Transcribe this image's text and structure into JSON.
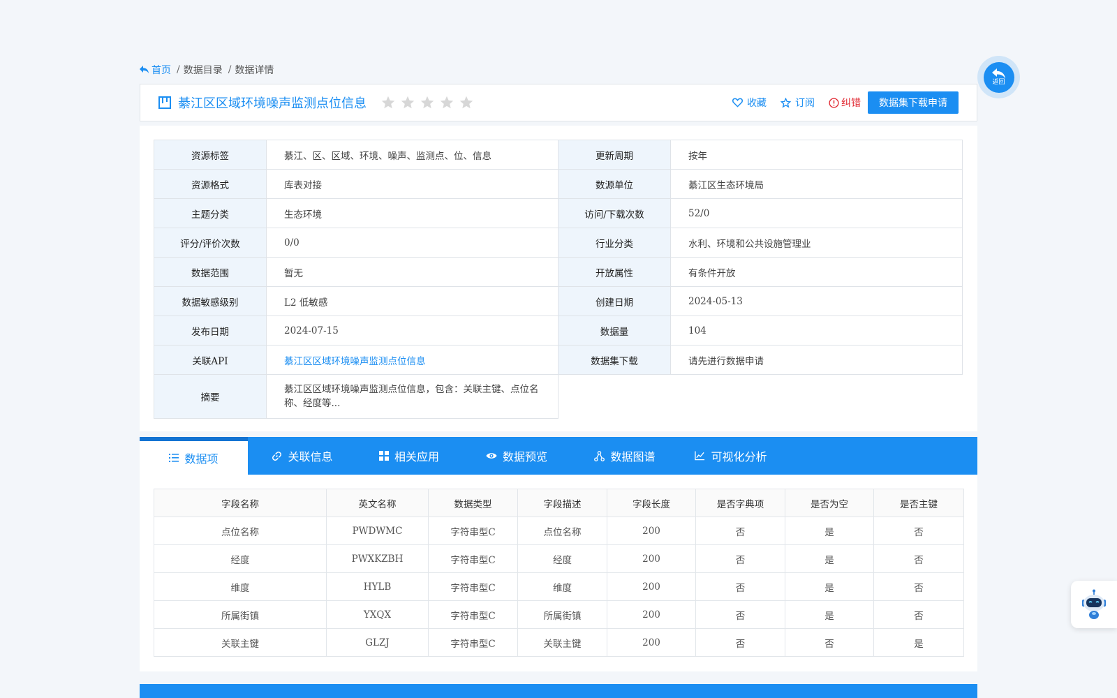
{
  "breadcrumb": {
    "home": "首页",
    "items": [
      "数据目录",
      "数据详情"
    ],
    "separator": "/"
  },
  "header": {
    "title": "綦江区区域环境噪声监测点位信息",
    "rating_stars": 0,
    "rating_max": 5,
    "actions": {
      "favorite": "收藏",
      "subscribe": "订阅",
      "report_error": "纠错"
    },
    "apply_button": "数据集下载申请"
  },
  "info": {
    "rows": [
      {
        "k1": "资源标签",
        "v1": "綦江、区、区域、环境、噪声、监测点、位、信息",
        "k2": "更新周期",
        "v2": "按年"
      },
      {
        "k1": "资源格式",
        "v1": "库表对接",
        "k2": "数源单位",
        "v2": "綦江区生态环境局"
      },
      {
        "k1": "主题分类",
        "v1": "生态环境",
        "k2": "访问/下载次数",
        "v2": "52/0"
      },
      {
        "k1": "评分/评价次数",
        "v1": "0/0",
        "k2": "行业分类",
        "v2": "水利、环境和公共设施管理业"
      },
      {
        "k1": "数据范围",
        "v1": "暂无",
        "k2": "开放属性",
        "v2": "有条件开放"
      },
      {
        "k1": "数据敏感级别",
        "v1": "L2 低敏感",
        "k2": "创建日期",
        "v2": "2024-05-13"
      },
      {
        "k1": "发布日期",
        "v1": "2024-07-15",
        "k2": "数据量",
        "v2": "104"
      },
      {
        "k1": "关联API",
        "v1": "綦江区区域环境噪声监测点位信息",
        "k2": "数据集下载",
        "v2": "请先进行数据申请"
      }
    ],
    "summary_label": "摘要",
    "summary_value": "綦江区区域环境噪声监测点位信息，包含：关联主键、点位名称、经度等..."
  },
  "tabs": [
    "数据项",
    "关联信息",
    "相关应用",
    "数据预览",
    "数据图谱",
    "可视化分析"
  ],
  "fields_table": {
    "headers": [
      "字段名称",
      "英文名称",
      "数据类型",
      "字段描述",
      "字段长度",
      "是否字典项",
      "是否为空",
      "是否主键"
    ],
    "rows": [
      [
        "点位名称",
        "PWDWMC",
        "字符串型C",
        "点位名称",
        "200",
        "否",
        "是",
        "否"
      ],
      [
        "经度",
        "PWXKZBH",
        "字符串型C",
        "经度",
        "200",
        "否",
        "是",
        "否"
      ],
      [
        "维度",
        "HYLB",
        "字符串型C",
        "维度",
        "200",
        "否",
        "是",
        "否"
      ],
      [
        "所属街镇",
        "YXQX",
        "字符串型C",
        "所属街镇",
        "200",
        "否",
        "是",
        "否"
      ],
      [
        "关联主键",
        "GLZJ",
        "字符串型C",
        "关联主键",
        "200",
        "否",
        "否",
        "是"
      ]
    ]
  },
  "back_button": "返回",
  "colors": {
    "primary": "#1b8ef2",
    "error": "#e0262f",
    "label_bg": "#eef5fc"
  }
}
